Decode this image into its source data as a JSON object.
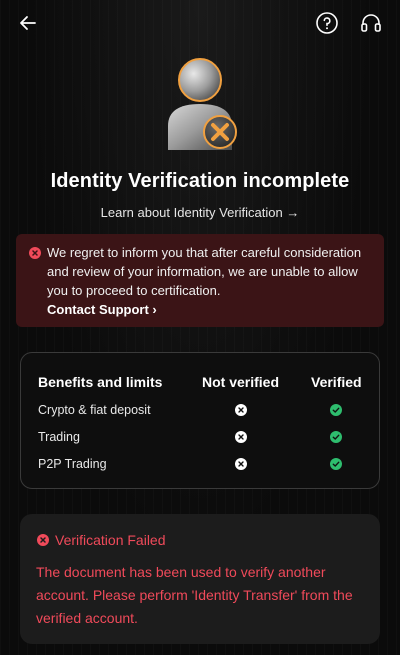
{
  "header": {
    "back_icon": "back-arrow-icon",
    "help_icon": "help-circle-icon",
    "support_icon": "headset-icon"
  },
  "hero": {
    "icon": "user-verification-failed-icon"
  },
  "title": "Identity Verification incomplete",
  "learn_link": "Learn about Identity Verification →",
  "alert": {
    "message": "We regret to inform you that after careful consideration and review of your information, we are unable to allow you to proceed to certification.",
    "contact_label": "Contact Support ›"
  },
  "benefits": {
    "headers": [
      "Benefits and limits",
      "Not verified",
      "Verified"
    ],
    "rows": [
      {
        "label": "Crypto & fiat deposit",
        "not_verified": false,
        "verified": true
      },
      {
        "label": "Trading",
        "not_verified": false,
        "verified": true
      },
      {
        "label": "P2P Trading",
        "not_verified": false,
        "verified": true
      }
    ]
  },
  "failed": {
    "title": "Verification Failed",
    "message": "The document has been used to verify another account. Please perform 'Identity Transfer' from the verified account."
  },
  "colors": {
    "error": "#f04a5a",
    "success": "#2ebd6e",
    "accent_orange": "#f0a040",
    "alert_bg": "#3b1416"
  }
}
